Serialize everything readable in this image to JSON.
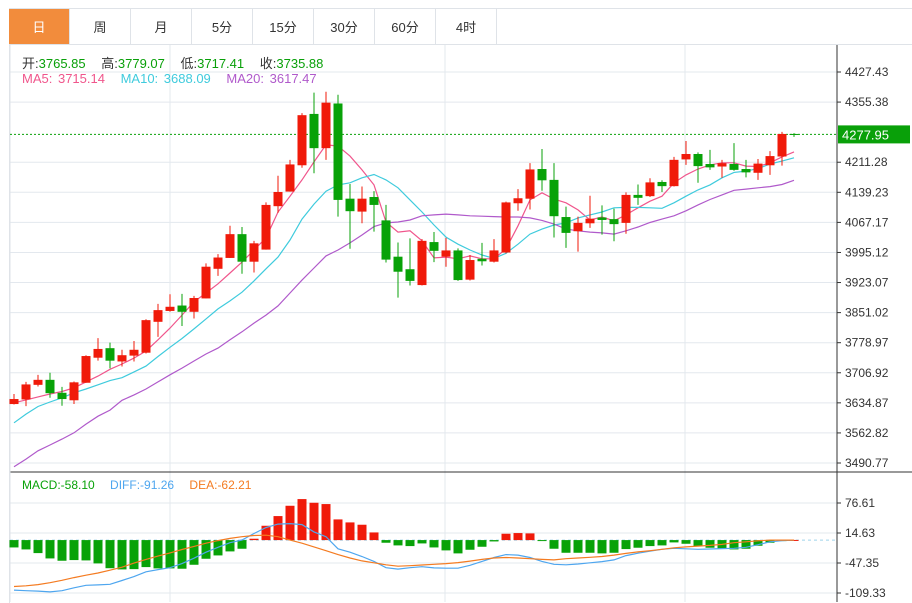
{
  "tabs": [
    {
      "label": "日",
      "active": true
    },
    {
      "label": "周",
      "active": false
    },
    {
      "label": "月",
      "active": false
    },
    {
      "label": "5分",
      "active": false
    },
    {
      "label": "15分",
      "active": false
    },
    {
      "label": "30分",
      "active": false
    },
    {
      "label": "60分",
      "active": false
    },
    {
      "label": "4时",
      "active": false
    }
  ],
  "ohlc_info": {
    "open_label": "开:",
    "open": "3765.85",
    "high_label": "高:",
    "high": "3779.07",
    "low_label": "低:",
    "low": "3717.41",
    "close_label": "收:",
    "close": "3735.88"
  },
  "ma_info": {
    "ma5_label": "MA5:",
    "ma5": "3715.14",
    "ma10_label": "MA10:",
    "ma10": "3688.09",
    "ma20_label": "MA20:",
    "ma20": "3617.47"
  },
  "macd_info": {
    "macd_label": "MACD:",
    "macd": "-58.10",
    "diff_label": "DIFF:",
    "diff": "-91.26",
    "dea_label": "DEA:",
    "dea": "-62.21"
  },
  "colors": {
    "up": "#f01a0a",
    "down": "#08a208",
    "ma5": "#f0568c",
    "ma10": "#3fcbdd",
    "ma20": "#b05acb",
    "diff": "#4ea6ef",
    "dea": "#f47b21",
    "active_tab": "#f28c3c",
    "price_marker": "#09a009"
  },
  "chart_data": [
    {
      "type": "candlestick",
      "y_ticks": [
        "4427.43",
        "4355.38",
        "4211.28",
        "4139.23",
        "4067.17",
        "3995.12",
        "3923.07",
        "3851.02",
        "3778.97",
        "3706.92",
        "3634.87",
        "3562.82",
        "3490.77"
      ],
      "ylim": [
        3490.77,
        4427.43
      ],
      "current_price": "4277.95",
      "grid": true,
      "ohlc": [
        [
          3632,
          3656,
          3631,
          3644
        ],
        [
          3643,
          3685,
          3627,
          3679
        ],
        [
          3678,
          3702,
          3674,
          3690
        ],
        [
          3690,
          3707,
          3647,
          3658
        ],
        [
          3659,
          3673,
          3628,
          3644
        ],
        [
          3641,
          3686,
          3632,
          3684
        ],
        [
          3683,
          3749,
          3683,
          3747
        ],
        [
          3743,
          3790,
          3736,
          3764
        ],
        [
          3765.85,
          3779.07,
          3717.41,
          3735.88
        ],
        [
          3734,
          3762,
          3722,
          3749
        ],
        [
          3748,
          3783,
          3734,
          3762
        ],
        [
          3755,
          3835,
          3753,
          3833
        ],
        [
          3829,
          3872,
          3793,
          3857
        ],
        [
          3855,
          3895,
          3853,
          3865
        ],
        [
          3868,
          3896,
          3819,
          3853
        ],
        [
          3853,
          3891,
          3837,
          3886
        ],
        [
          3885,
          3969,
          3885,
          3961
        ],
        [
          3956,
          3991,
          3939,
          3983
        ],
        [
          3982,
          4059,
          3982,
          4039
        ],
        [
          4039,
          4056,
          3944,
          3973
        ],
        [
          3973,
          4023,
          3947,
          4017
        ],
        [
          4002,
          4115,
          4002,
          4109
        ],
        [
          4106,
          4179,
          4090,
          4140
        ],
        [
          4141,
          4217,
          4141,
          4206
        ],
        [
          4204,
          4329,
          4198,
          4324
        ],
        [
          4327,
          4378,
          4185,
          4245
        ],
        [
          4245,
          4380,
          4217,
          4354
        ],
        [
          4352,
          4373,
          4081,
          4121
        ],
        [
          4124,
          4159,
          4004,
          4094
        ],
        [
          4093,
          4153,
          4065,
          4124
        ],
        [
          4128,
          4142,
          4045,
          4109
        ],
        [
          4072,
          4109,
          3971,
          3978
        ],
        [
          3985,
          4019,
          3887,
          3949
        ],
        [
          3955,
          4029,
          3916,
          3927
        ],
        [
          3917,
          4027,
          3916,
          4023
        ],
        [
          4020,
          4044,
          3972,
          3999
        ],
        [
          3985,
          4030,
          3961,
          4000
        ],
        [
          4000,
          4005,
          3927,
          3929
        ],
        [
          3930,
          3989,
          3928,
          3977
        ],
        [
          3980,
          4018,
          3964,
          3974
        ],
        [
          3973,
          4027,
          3971,
          4000
        ],
        [
          3995,
          4117,
          3993,
          4115
        ],
        [
          4113,
          4147,
          4095,
          4125
        ],
        [
          4124,
          4209,
          4098,
          4194
        ],
        [
          4195,
          4243,
          4143,
          4168
        ],
        [
          4169,
          4209,
          4031,
          4082
        ],
        [
          4080,
          4105,
          4006,
          4042
        ],
        [
          4046,
          4081,
          3997,
          4066
        ],
        [
          4065,
          4131,
          4054,
          4076
        ],
        [
          4079,
          4108,
          4038,
          4073
        ],
        [
          4075,
          4100,
          4022,
          4063
        ],
        [
          4066,
          4139,
          4040,
          4133
        ],
        [
          4133,
          4158,
          4109,
          4126
        ],
        [
          4130,
          4173,
          4128,
          4163
        ],
        [
          4164,
          4168,
          4140,
          4154
        ],
        [
          4154,
          4224,
          4153,
          4217
        ],
        [
          4218,
          4262,
          4205,
          4231
        ],
        [
          4231,
          4235,
          4162,
          4202
        ],
        [
          4207,
          4241,
          4193,
          4199
        ],
        [
          4201,
          4217,
          4174,
          4209
        ],
        [
          4207,
          4257,
          4191,
          4193
        ],
        [
          4195,
          4217,
          4175,
          4187
        ],
        [
          4186,
          4219,
          4169,
          4208
        ],
        [
          4204,
          4238,
          4181,
          4226
        ],
        [
          4225,
          4284,
          4203,
          4279
        ],
        [
          4279,
          4281,
          4272,
          4277.95
        ]
      ],
      "series": [
        {
          "name": "MA5",
          "values": [
            3635,
            3642,
            3649,
            3656,
            3662,
            3671,
            3685,
            3699,
            3715.14,
            3728,
            3742,
            3759,
            3786,
            3814,
            3845,
            3877,
            3898,
            3920,
            3946,
            3972,
            4001,
            4030,
            4092,
            4130,
            4169,
            4212,
            4253,
            4250,
            4226,
            4193,
            4157,
            4068,
            4044,
            4047,
            4023,
            3982,
            3984,
            3980,
            3987,
            3980,
            3980,
            4004,
            4059,
            4121,
            4138,
            4123,
            4114,
            4097,
            4073,
            4080,
            4071,
            4085,
            4102,
            4118,
            4130,
            4162,
            4181,
            4195,
            4205,
            4210,
            4210,
            4202,
            4201,
            4210,
            4224,
            4236
          ]
        },
        {
          "name": "MA10",
          "values": [
            3587,
            3608,
            3626,
            3637,
            3647,
            3659,
            3668,
            3678,
            3688.09,
            3695,
            3709,
            3723,
            3746,
            3768,
            3789,
            3812,
            3836,
            3860,
            3879,
            3900,
            3927,
            3956,
            3984,
            4025,
            4075,
            4111,
            4142,
            4157,
            4162,
            4174,
            4182,
            4169,
            4150,
            4121,
            4092,
            4061,
            4032,
            4015,
            4001,
            3989,
            3981,
            3993,
            4015,
            4039,
            4051,
            4061,
            4066,
            4078,
            4085,
            4092,
            4102,
            4103,
            4103,
            4102,
            4101,
            4114,
            4130,
            4145,
            4157,
            4174,
            4187,
            4190,
            4196,
            4207,
            4214,
            4222
          ]
        },
        {
          "name": "MA20",
          "values": [
            3482,
            3500,
            3520,
            3534,
            3548,
            3563,
            3584,
            3603,
            3617.47,
            3641,
            3654,
            3668,
            3685,
            3702,
            3718,
            3735,
            3752,
            3766,
            3786,
            3805,
            3826,
            3845,
            3867,
            3898,
            3929,
            3958,
            3987,
            4001,
            4018,
            4037,
            4057,
            4066,
            4068,
            4073,
            4083,
            4085,
            4087,
            4085,
            4083,
            4082,
            4081,
            4080,
            4080,
            4078,
            4072,
            4063,
            4051,
            4047,
            4044,
            4042,
            4039,
            4047,
            4056,
            4067,
            4075,
            4083,
            4095,
            4109,
            4122,
            4133,
            4144,
            4147,
            4150,
            4153,
            4158,
            4168
          ]
        }
      ]
    },
    {
      "type": "bar+line",
      "y_ticks": [
        "76.61",
        "14.63",
        "-47.35",
        "-109.33"
      ],
      "ylim": [
        -109.33,
        76.61
      ],
      "macd": [
        -15.2,
        -19.3,
        -26.9,
        -37.9,
        -42.7,
        -41.3,
        -42.0,
        -48.2,
        -58.1,
        -60.6,
        -60.0,
        -55.8,
        -58.5,
        -58.5,
        -59.2,
        -51.0,
        -38.6,
        -31.7,
        -23.4,
        -17.9,
        2.8,
        29.6,
        49.6,
        70.9,
        84.7,
        77.1,
        74.4,
        42.7,
        36.5,
        31.7,
        15.8,
        -5.5,
        -11.0,
        -12.4,
        -6.9,
        -15.2,
        -21.3,
        -27.5,
        -20.0,
        -13.8,
        -2.8,
        13.1,
        14.5,
        13.8,
        -1.4,
        -17.9,
        -26.2,
        -26.2,
        -26.2,
        -27.5,
        -26.2,
        -18.6,
        -15.8,
        -12.4,
        -11.0,
        -4.8,
        -7.6,
        -12.4,
        -15.8,
        -17.2,
        -19.3,
        -17.9,
        -11.7,
        -5.5,
        -0.7,
        0.3
      ],
      "series": [
        {
          "name": "DIFF",
          "values": [
            -103.3,
            -104.5,
            -105.5,
            -107,
            -104.5,
            -98.5,
            -93.5,
            -92.5,
            -91.26,
            -83.5,
            -75.5,
            -65.5,
            -61,
            -57,
            -48.5,
            -37.5,
            -25,
            -15,
            -5.5,
            0.2,
            13.5,
            26,
            33,
            34,
            32,
            17,
            7,
            -18,
            -25,
            -34,
            -44,
            -57,
            -60,
            -57,
            -55,
            -57.5,
            -58,
            -58,
            -52,
            -44,
            -36,
            -30,
            -31,
            -36,
            -44,
            -50,
            -51,
            -49.5,
            -47,
            -44.5,
            -41,
            -32,
            -27,
            -23,
            -19,
            -17,
            -18,
            -19,
            -18.5,
            -17.5,
            -17,
            -15,
            -9.5,
            -3.5,
            -1,
            0
          ]
        },
        {
          "name": "DEA",
          "values": [
            -96,
            -94.5,
            -92,
            -88,
            -83,
            -77.5,
            -72.5,
            -68,
            -62.21,
            -56,
            -47.5,
            -40,
            -33,
            -26.5,
            -19.5,
            -13,
            -6.5,
            -1,
            3.5,
            7,
            9.5,
            10,
            7,
            0,
            -6.5,
            -14,
            -22,
            -30,
            -37,
            -43,
            -47,
            -51,
            -54,
            -53,
            -51.5,
            -50,
            -48.5,
            -46.5,
            -43.5,
            -40,
            -37,
            -36,
            -37,
            -38.5,
            -40,
            -41,
            -38.5,
            -37,
            -35.5,
            -34,
            -31,
            -27.5,
            -24.5,
            -22,
            -19,
            -16,
            -14,
            -12.5,
            -11,
            -9,
            -5.5,
            -3.5,
            -1.5,
            0,
            0,
            0
          ]
        }
      ]
    }
  ]
}
